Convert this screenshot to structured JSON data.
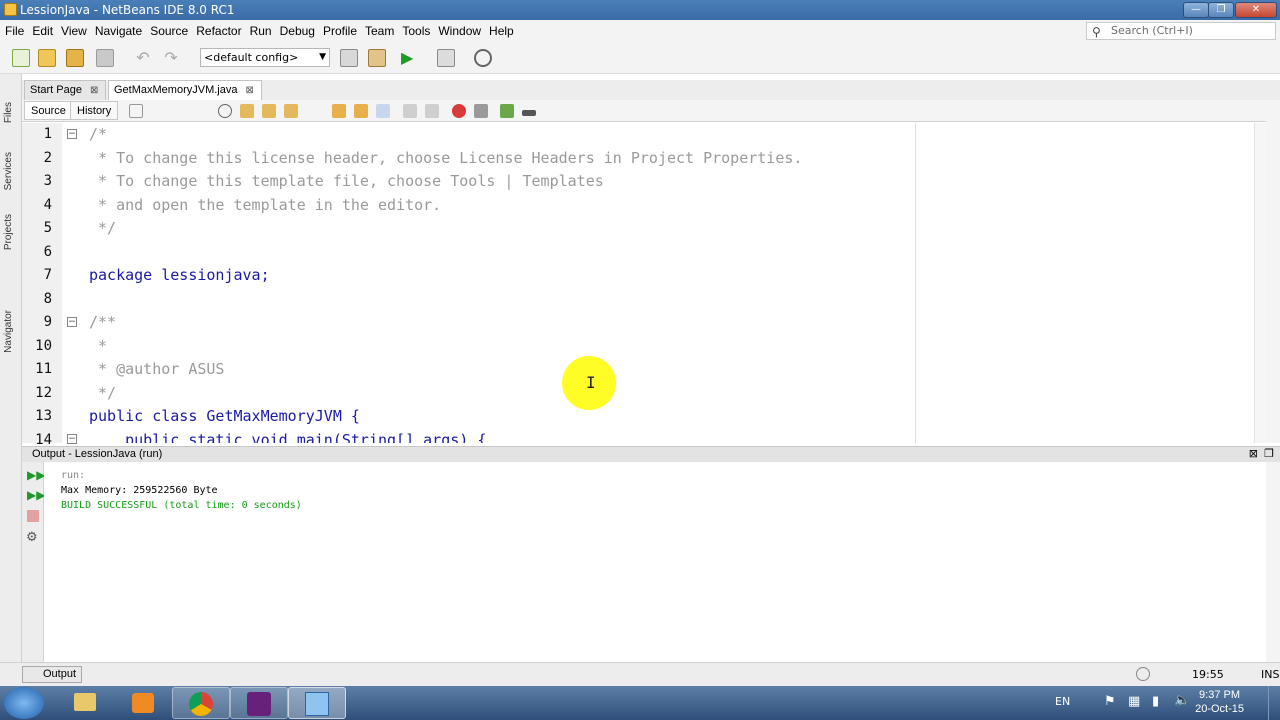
{
  "window": {
    "title": "LessionJava - NetBeans IDE 8.0 RC1"
  },
  "menu": [
    "File",
    "Edit",
    "View",
    "Navigate",
    "Source",
    "Refactor",
    "Run",
    "Debug",
    "Profile",
    "Team",
    "Tools",
    "Window",
    "Help"
  ],
  "search": {
    "placeholder": "Search (Ctrl+I)"
  },
  "toolbar": {
    "config": "<default config>"
  },
  "left_panels": [
    "Files",
    "Services",
    "Projects",
    "Navigator"
  ],
  "tabs": [
    {
      "label": "Start Page"
    },
    {
      "label": "GetMaxMemoryJVM.java"
    }
  ],
  "editor_toolbar": {
    "source": "Source",
    "history": "History"
  },
  "editor": {
    "line_numbers": [
      "1",
      "2",
      "3",
      "4",
      "5",
      "6",
      "7",
      "8",
      "9",
      "10",
      "11",
      "12",
      "13",
      "14"
    ],
    "lines": [
      "/*",
      " * To change this license header, choose License Headers in Project Properties.",
      " * To change this template file, choose Tools | Templates",
      " * and open the template in the editor.",
      " */",
      "",
      "package lessionjava;",
      "",
      "/**",
      " *",
      " * @author ASUS",
      " */",
      "public class GetMaxMemoryJVM {",
      "    public static void main(String[] args) {"
    ]
  },
  "output": {
    "title": "Output - LessionJava (run)",
    "lines": [
      {
        "text": "run:",
        "color": "#8a8a8a"
      },
      {
        "text": "Max Memory: 259522560 Byte",
        "color": "#000000"
      },
      {
        "text": "BUILD SUCCESSFUL (total time: 0 seconds)",
        "color": "#1a9a1a"
      }
    ]
  },
  "status": {
    "output_button": "Output",
    "position": "19:55",
    "mode": "INS"
  },
  "taskbar": {
    "lang": "EN",
    "time": "9:37 PM",
    "date": "20-Oct-15"
  }
}
